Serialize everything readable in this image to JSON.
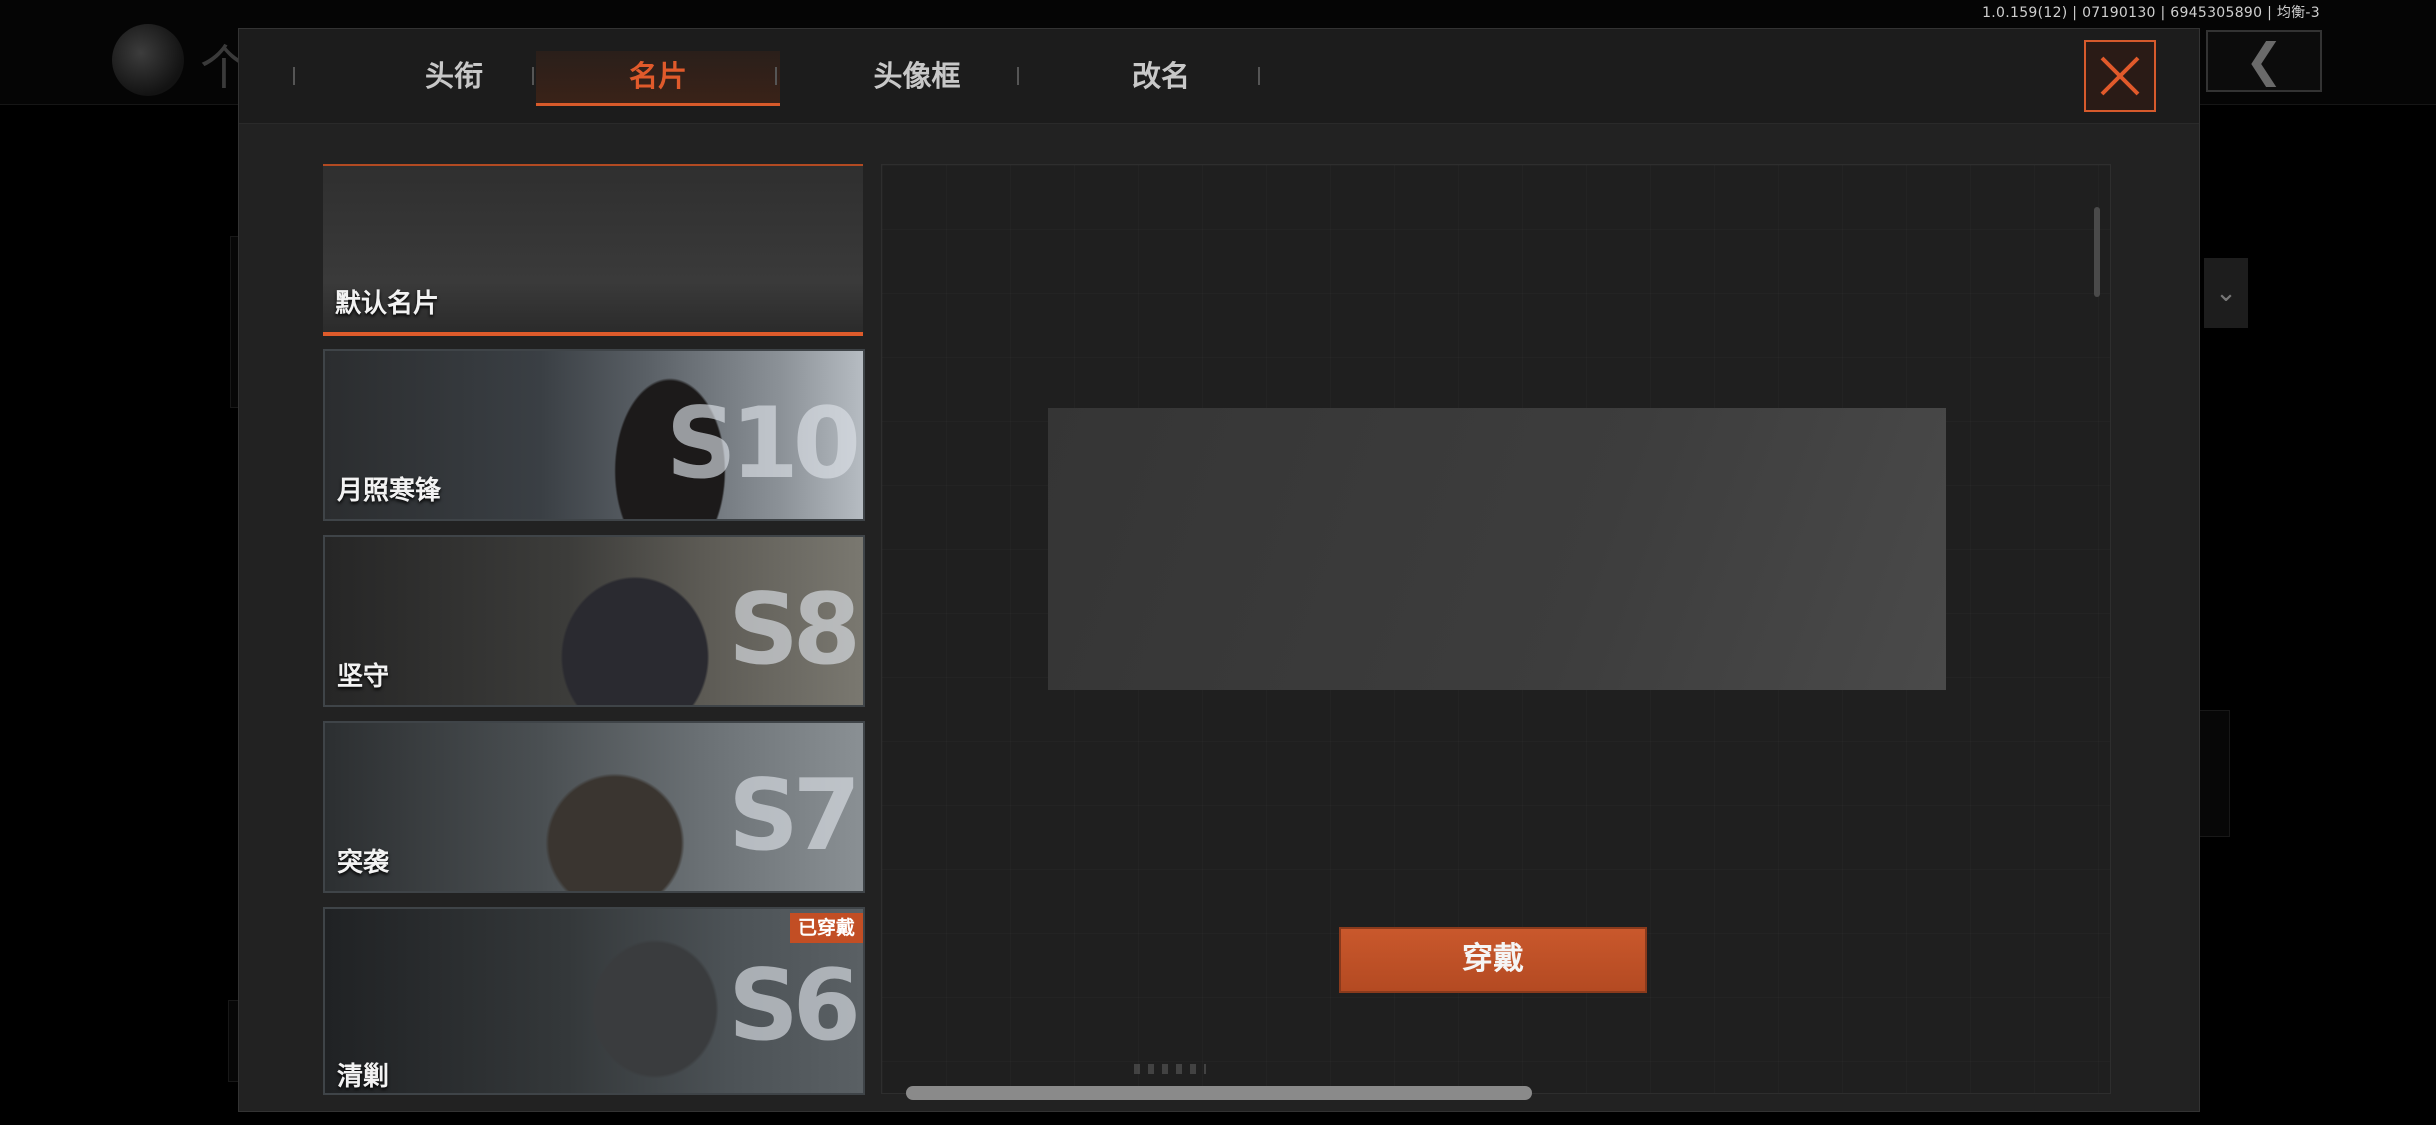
{
  "status_bar": {
    "version": "1.0.159(12) | 07190130 | 6945305890 | 均衡-3"
  },
  "background": {
    "title_fragment": "个"
  },
  "tabs": [
    {
      "label": "头衔",
      "active": false
    },
    {
      "label": "名片",
      "active": true
    },
    {
      "label": "头像框",
      "active": false
    },
    {
      "label": "改名",
      "active": false
    }
  ],
  "cards": [
    {
      "label": "默认名片",
      "season": "",
      "badge": "",
      "selected": true
    },
    {
      "label": "月照寒锋",
      "season": "S10",
      "badge": "",
      "selected": false
    },
    {
      "label": "坚守",
      "season": "S8",
      "badge": "",
      "selected": false
    },
    {
      "label": "突袭",
      "season": "S7",
      "badge": "",
      "selected": false
    },
    {
      "label": "清剿",
      "season": "S6",
      "badge": "已穿戴",
      "selected": false
    }
  ],
  "preview": {
    "wear_button": "穿戴"
  },
  "colors": {
    "accent": "#de5b2b",
    "panel": "#222222",
    "tabbar": "#1c1c1c"
  },
  "icons": {
    "close": "close-icon",
    "back": "back-chevron-icon"
  }
}
